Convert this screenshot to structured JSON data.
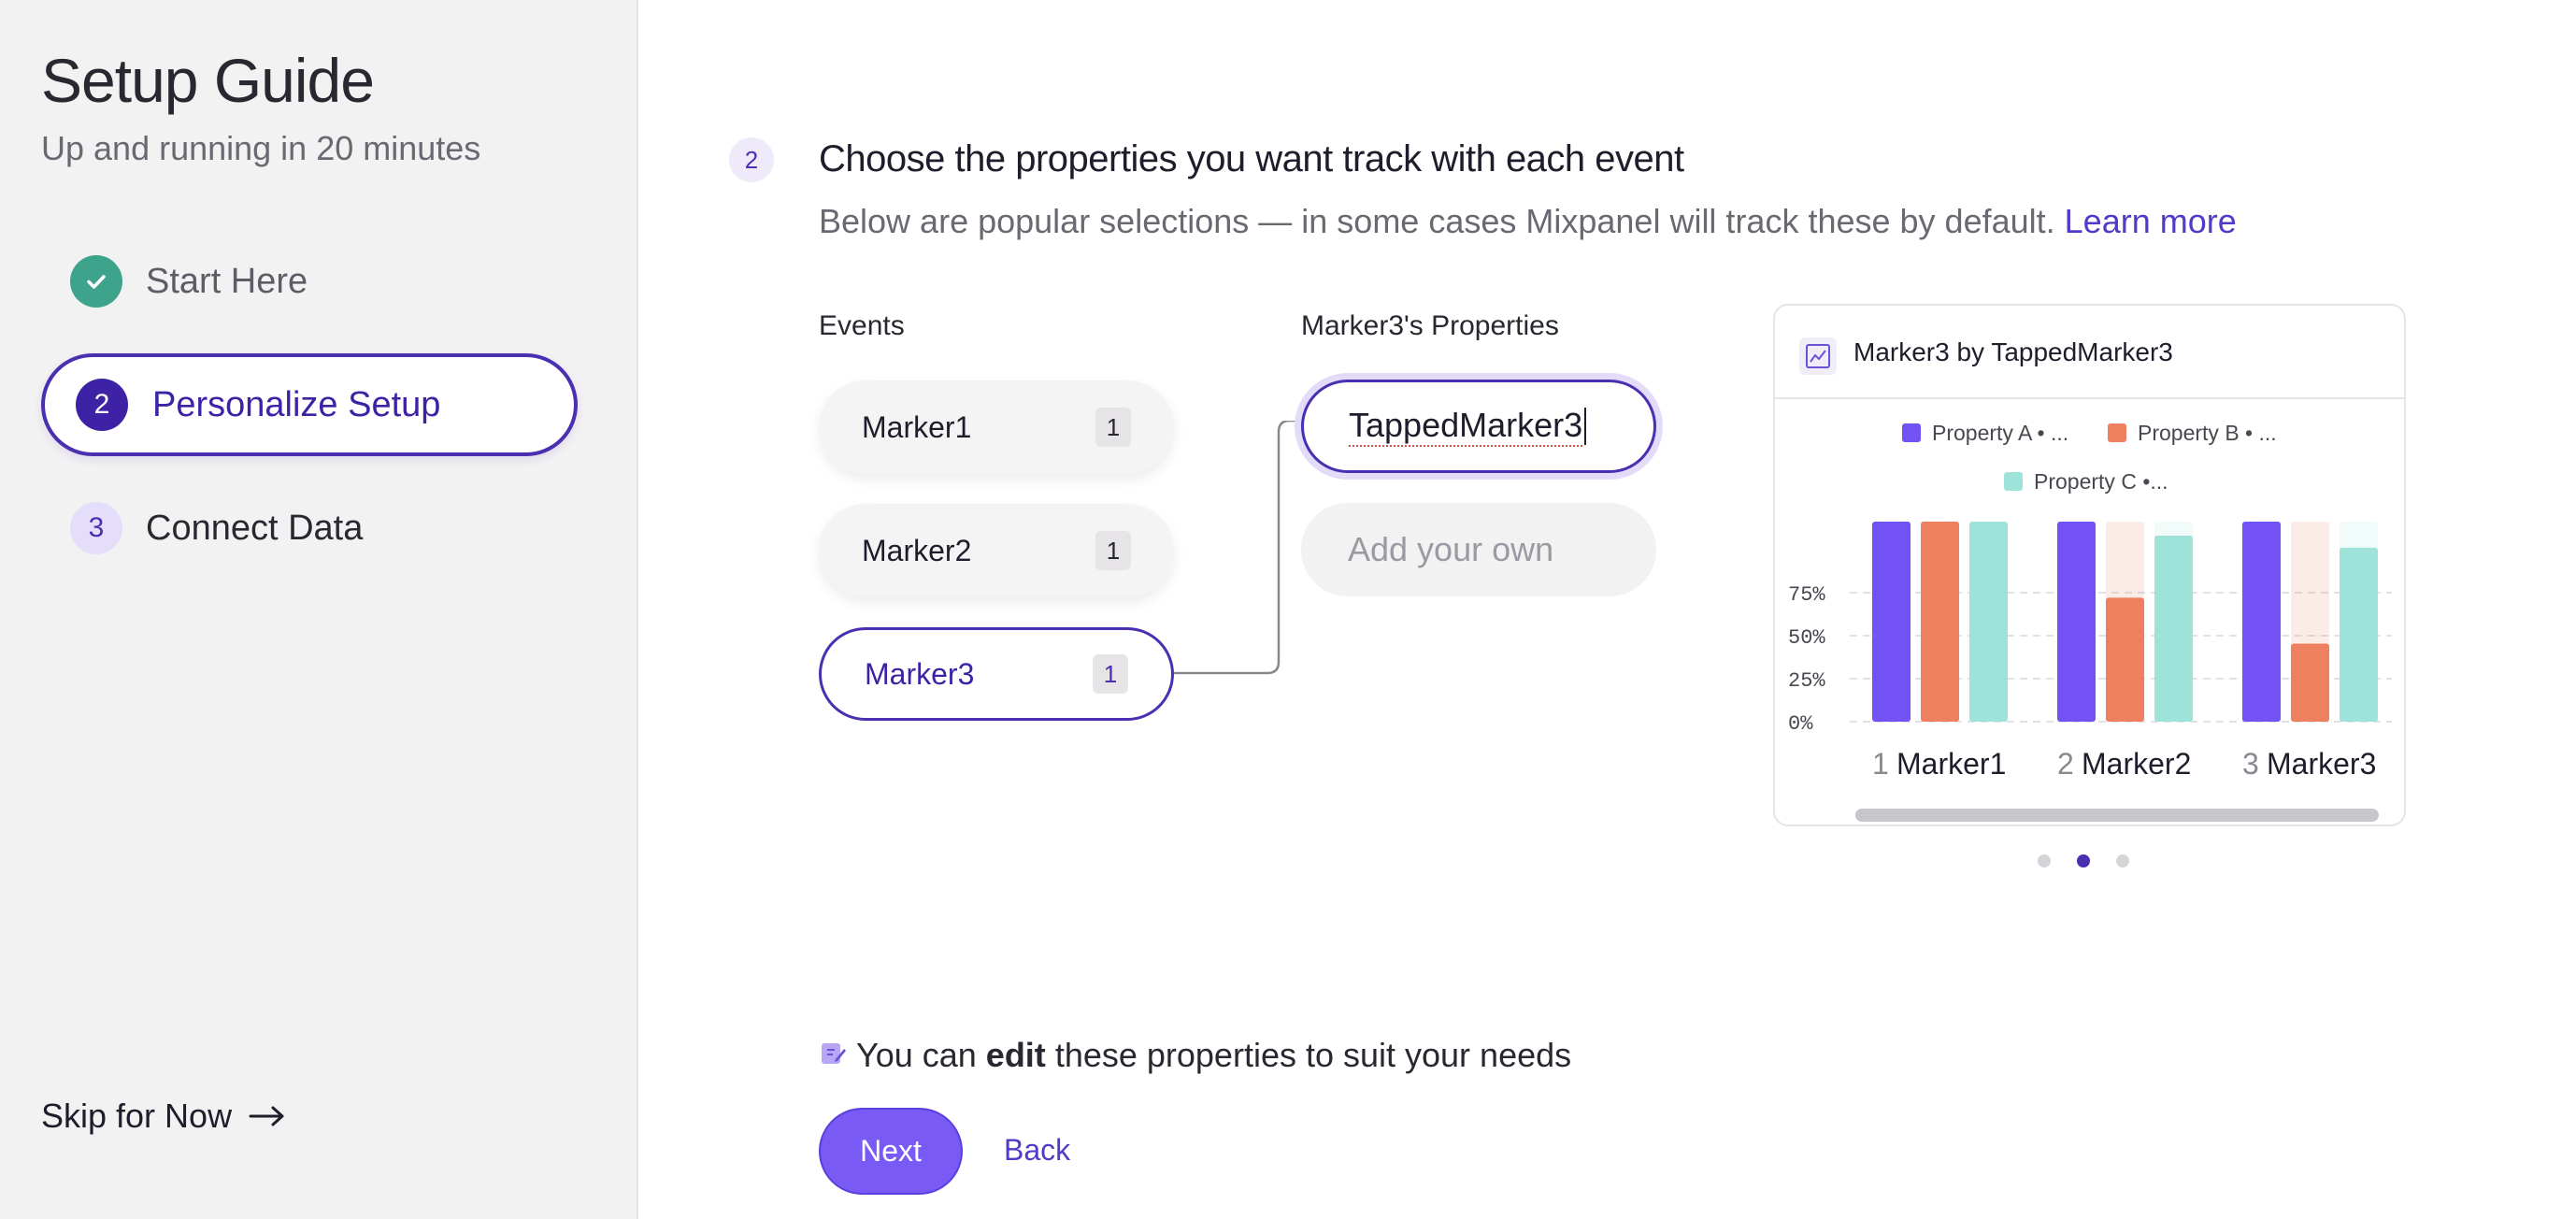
{
  "sidebar": {
    "title": "Setup Guide",
    "subtitle": "Up and running in 20 minutes",
    "steps": [
      {
        "badge": "",
        "label": "Start Here",
        "state": "done"
      },
      {
        "badge": "2",
        "label": "Personalize Setup",
        "state": "active"
      },
      {
        "badge": "3",
        "label": "Connect Data",
        "state": "pending"
      }
    ],
    "skip_label": "Skip for Now"
  },
  "main": {
    "step_number": "2",
    "heading": "Choose the properties you want track with each event",
    "description": "Below are popular selections — in some cases Mixpanel will track these by default.",
    "learn_more": "Learn more",
    "events_label": "Events",
    "events": [
      {
        "name": "Marker1",
        "count": "1"
      },
      {
        "name": "Marker2",
        "count": "1"
      },
      {
        "name": "Marker3",
        "count": "1"
      }
    ],
    "properties_label": "Marker3's Properties",
    "property_value": "TappedMarker3",
    "add_placeholder": "Add your own",
    "edit_note_prefix": "You can",
    "edit_note_bold": "edit",
    "edit_note_suffix": "these properties to suit your needs",
    "next_label": "Next",
    "back_label": "Back"
  },
  "colors": {
    "accent": "#4a2fb0",
    "button": "#7a5af5",
    "success": "#3ea38b",
    "property_a": "#7352f5",
    "property_b": "#ee7f5f",
    "property_c": "#9ee3d9"
  },
  "chart_data": {
    "type": "bar",
    "title": "Marker3 by TappedMarker3",
    "legend": [
      "Property A • ...",
      "Property B • ...",
      "Property C •..."
    ],
    "category_prefixes": [
      "1",
      "2",
      "3"
    ],
    "categories": [
      "Marker1",
      "Marker2",
      "Marker3"
    ],
    "y_ticks": [
      "75%",
      "50%",
      "25%",
      "0%"
    ],
    "series": [
      {
        "name": "Property A • ...",
        "values": [
          100,
          100,
          100
        ]
      },
      {
        "name": "Property B • ...",
        "values": [
          100,
          62,
          39
        ]
      },
      {
        "name": "Property C •...",
        "values": [
          100,
          93,
          87
        ]
      }
    ],
    "ylim": [
      0,
      100
    ],
    "grid": true,
    "legend_position": "top"
  },
  "carousel": {
    "count": 3,
    "active": 1
  }
}
